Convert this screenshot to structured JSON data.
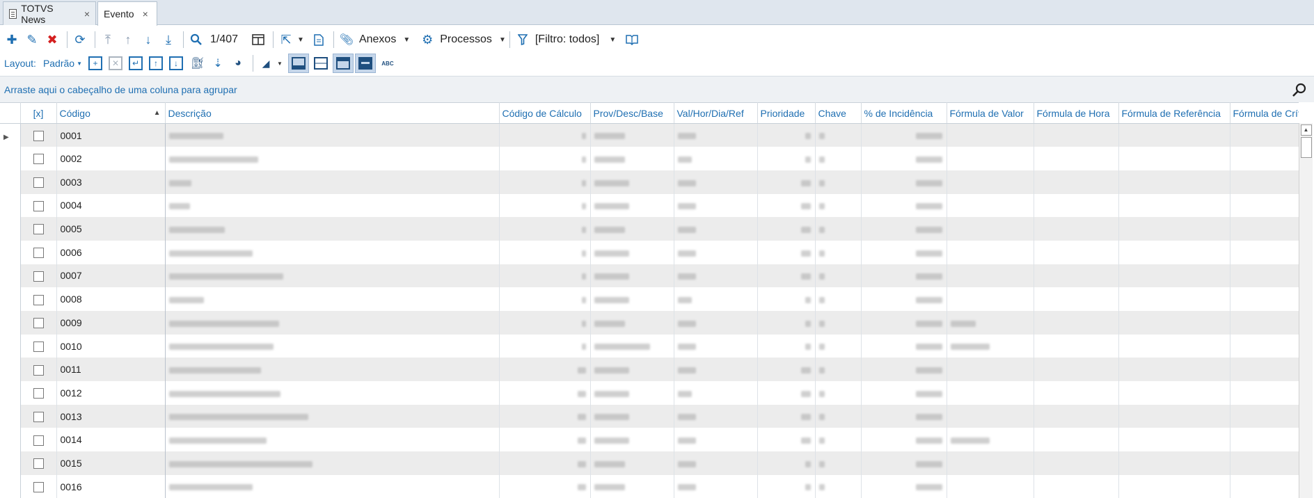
{
  "tabs": [
    {
      "label": "TOTVS News",
      "close": "×",
      "icon": "document-icon"
    },
    {
      "label": "Evento",
      "close": "×"
    }
  ],
  "toolbar": {
    "record_counter": "1/407",
    "anexos_label": "Anexos",
    "processos_label": "Processos",
    "filter_label": "[Filtro: todos]"
  },
  "layout_bar": {
    "label": "Layout:",
    "value": "Padrão"
  },
  "group_bar": {
    "hint": "Arraste aqui o cabeçalho de uma coluna para agrupar"
  },
  "grid": {
    "columns": [
      {
        "label": ""
      },
      {
        "label": "[x]"
      },
      {
        "label": "Código"
      },
      {
        "label": "Descrição"
      },
      {
        "label": "Código de Cálculo"
      },
      {
        "label": "Prov/Desc/Base"
      },
      {
        "label": "Val/Hor/Dia/Ref"
      },
      {
        "label": "Prioridade"
      },
      {
        "label": "Chave"
      },
      {
        "label": "% de Incidência"
      },
      {
        "label": "Fórmula de Valor"
      },
      {
        "label": "Fórmula de Hora"
      },
      {
        "label": "Fórmula de Referência"
      },
      {
        "label": "Fórmula de Crítica"
      }
    ],
    "rows": [
      {
        "code": "0001",
        "desc_w": 78,
        "calc_w": 6,
        "prov_w": 44,
        "val_w": 26,
        "prio_w": 8,
        "fv_w": 0
      },
      {
        "code": "0002",
        "desc_w": 128,
        "calc_w": 6,
        "prov_w": 44,
        "val_w": 20,
        "prio_w": 8,
        "fv_w": 0
      },
      {
        "code": "0003",
        "desc_w": 32,
        "calc_w": 6,
        "prov_w": 50,
        "val_w": 26,
        "prio_w": 14,
        "fv_w": 0
      },
      {
        "code": "0004",
        "desc_w": 30,
        "calc_w": 6,
        "prov_w": 50,
        "val_w": 26,
        "prio_w": 14,
        "fv_w": 0
      },
      {
        "code": "0005",
        "desc_w": 80,
        "calc_w": 6,
        "prov_w": 44,
        "val_w": 26,
        "prio_w": 14,
        "fv_w": 0
      },
      {
        "code": "0006",
        "desc_w": 120,
        "calc_w": 6,
        "prov_w": 50,
        "val_w": 26,
        "prio_w": 14,
        "fv_w": 0
      },
      {
        "code": "0007",
        "desc_w": 164,
        "calc_w": 6,
        "prov_w": 50,
        "val_w": 26,
        "prio_w": 14,
        "fv_w": 0
      },
      {
        "code": "0008",
        "desc_w": 50,
        "calc_w": 6,
        "prov_w": 50,
        "val_w": 20,
        "prio_w": 8,
        "fv_w": 0
      },
      {
        "code": "0009",
        "desc_w": 158,
        "calc_w": 6,
        "prov_w": 44,
        "val_w": 26,
        "prio_w": 8,
        "fv_w": 36
      },
      {
        "code": "0010",
        "desc_w": 150,
        "calc_w": 6,
        "prov_w": 80,
        "val_w": 26,
        "prio_w": 8,
        "fv_w": 56
      },
      {
        "code": "0011",
        "desc_w": 132,
        "calc_w": 12,
        "prov_w": 50,
        "val_w": 26,
        "prio_w": 14,
        "fv_w": 0
      },
      {
        "code": "0012",
        "desc_w": 160,
        "calc_w": 12,
        "prov_w": 50,
        "val_w": 20,
        "prio_w": 14,
        "fv_w": 0
      },
      {
        "code": "0013",
        "desc_w": 200,
        "calc_w": 12,
        "prov_w": 50,
        "val_w": 26,
        "prio_w": 14,
        "fv_w": 0
      },
      {
        "code": "0014",
        "desc_w": 140,
        "calc_w": 12,
        "prov_w": 50,
        "val_w": 26,
        "prio_w": 14,
        "fv_w": 56
      },
      {
        "code": "0015",
        "desc_w": 206,
        "calc_w": 12,
        "prov_w": 44,
        "val_w": 26,
        "prio_w": 8,
        "fv_w": 0
      },
      {
        "code": "0016",
        "desc_w": 120,
        "calc_w": 12,
        "prov_w": 44,
        "val_w": 26,
        "prio_w": 8,
        "fv_w": 0
      }
    ]
  },
  "colors": {
    "accent": "#1f6fb2",
    "delete": "#d41f1f",
    "row_alt": "#ececec",
    "tabbar": "#dfe6ee"
  }
}
